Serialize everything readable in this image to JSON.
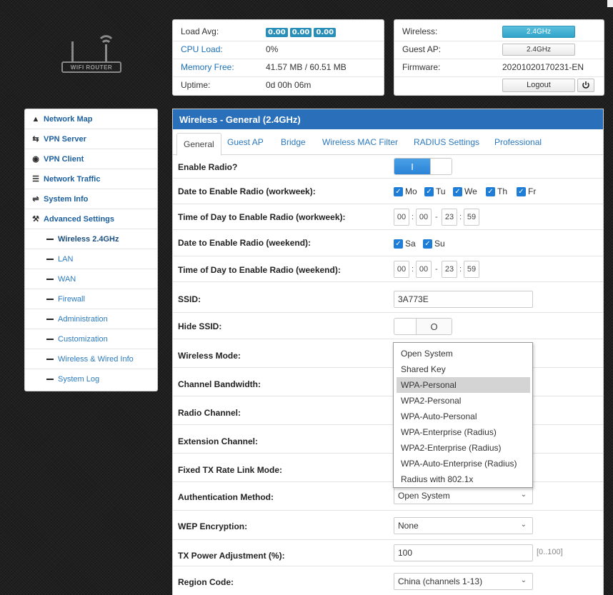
{
  "logo": {
    "text": "WIFI ROUTER"
  },
  "status": {
    "load_avg_label": "Load Avg:",
    "load_avg_values": [
      "0.00",
      "0.00",
      "0.00"
    ],
    "cpu_label": "CPU Load:",
    "cpu_value": "0%",
    "memory_label": "Memory Free:",
    "memory_value": "41.57 MB / 60.51 MB",
    "uptime_label": "Uptime:",
    "uptime_value": "0d 00h 06m",
    "wireless_label": "Wireless:",
    "wireless_btn": "2.4GHz",
    "guest_label": "Guest AP:",
    "guest_btn": "2.4GHz",
    "firmware_label": "Firmware:",
    "firmware_value": "20201020170231-EN",
    "logout": "Logout"
  },
  "sidebar": {
    "items": [
      {
        "label": "Network Map",
        "icon": "home-icon"
      },
      {
        "label": "VPN Server",
        "icon": "swap-icon"
      },
      {
        "label": "VPN Client",
        "icon": "globe-icon"
      },
      {
        "label": "Network Traffic",
        "icon": "list-icon"
      },
      {
        "label": "System Info",
        "icon": "shuffle-icon"
      },
      {
        "label": "Advanced Settings",
        "icon": "wrench-icon"
      }
    ],
    "subitems": [
      "Wireless 2.4GHz",
      "LAN",
      "WAN",
      "Firewall",
      "Administration",
      "Customization",
      "Wireless & Wired Info",
      "System Log"
    ]
  },
  "panel": {
    "title": "Wireless - General (2.4GHz)",
    "tabs": [
      "General",
      "Guest AP",
      "Bridge",
      "Wireless MAC Filter",
      "RADIUS Settings",
      "Professional"
    ],
    "fields": {
      "enable_radio": "Enable Radio?",
      "date_workweek": "Date to Enable Radio (workweek):",
      "time_workweek": "Time of Day to Enable Radio (workweek):",
      "date_weekend": "Date to Enable Radio (weekend):",
      "time_weekend": "Time of Day to Enable Radio (weekend):",
      "ssid": "SSID:",
      "hide_ssid": "Hide SSID:",
      "wireless_mode": "Wireless Mode:",
      "channel_bandwidth": "Channel Bandwidth:",
      "radio_channel": "Radio Channel:",
      "extension_channel": "Extension Channel:",
      "fixed_tx": "Fixed TX Rate Link Mode:",
      "auth_method": "Authentication Method:",
      "wep": "WEP Encryption:",
      "tx_power": "TX Power Adjustment (%):",
      "region": "Region Code:"
    },
    "toggle_on_glyph": "I",
    "toggle_off_glyph": "O",
    "workweek_days": [
      "Mo",
      "Tu",
      "We",
      "Th",
      "Fr"
    ],
    "weekend_days": [
      "Sa",
      "Su"
    ],
    "time_workweek": [
      "00",
      "00",
      "23",
      "59"
    ],
    "time_weekend": [
      "00",
      "00",
      "23",
      "59"
    ],
    "ssid_value": "3A773E",
    "auth_value": "Open System",
    "wep_value": "None",
    "tx_power_value": "100",
    "tx_power_hint": "[0..100]",
    "region_value": "China (channels 1-13)",
    "auth_options": [
      "Open System",
      "Shared Key",
      "WPA-Personal",
      "WPA2-Personal",
      "WPA-Auto-Personal",
      "WPA-Enterprise (Radius)",
      "WPA2-Enterprise (Radius)",
      "WPA-Auto-Enterprise (Radius)",
      "Radius with 802.1x"
    ]
  }
}
